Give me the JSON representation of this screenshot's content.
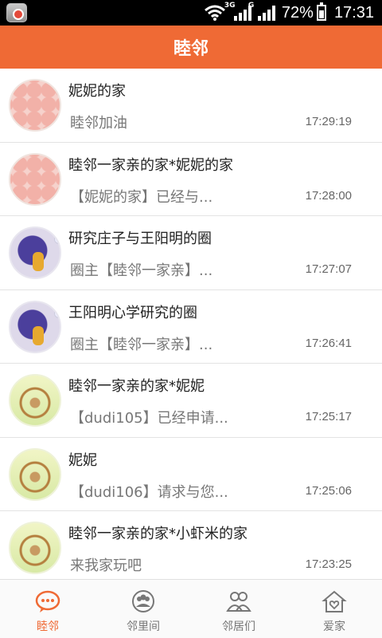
{
  "status_bar": {
    "network_type": "3G",
    "signal_label": "G",
    "battery_text": "72%",
    "battery_level": 0.72,
    "time": "17:31"
  },
  "app_bar": {
    "title": "睦邻"
  },
  "conversations": [
    {
      "name": "妮妮的家",
      "message": "睦邻加油",
      "time": "17:29:19",
      "avatar": "apples-photo"
    },
    {
      "name": "睦邻一家亲的家*妮妮的家",
      "message": "【妮妮的家】已经与...",
      "time": "17:28:00",
      "avatar": "apples-photo"
    },
    {
      "name": "研究庄子与王阳明的圈",
      "message": "圈主【睦邻一家亲】...",
      "time": "17:27:07",
      "avatar": "purple-art"
    },
    {
      "name": "王阳明心学研究的圈",
      "message": "圈主【睦邻一家亲】...",
      "time": "17:26:41",
      "avatar": "purple-art"
    },
    {
      "name": "睦邻一家亲的家*妮妮",
      "message": "【dudi105】已经申请...",
      "time": "17:25:17",
      "avatar": "wheel-illustration"
    },
    {
      "name": "妮妮",
      "message": "【dudi106】请求与您...",
      "time": "17:25:06",
      "avatar": "wheel-illustration"
    },
    {
      "name": "睦邻一家亲的家*小虾米的家",
      "message": "来我家玩吧",
      "time": "17:23:25",
      "avatar": "wheel-illustration"
    }
  ],
  "tabs": [
    {
      "label": "睦邻",
      "icon": "chat-bubble-icon",
      "active": true
    },
    {
      "label": "邻里间",
      "icon": "group-icon",
      "active": false
    },
    {
      "label": "邻居们",
      "icon": "people-icon",
      "active": false
    },
    {
      "label": "爱家",
      "icon": "home-heart-icon",
      "active": false
    }
  ],
  "colors": {
    "accent": "#ef6a35",
    "status_bar": "#000000",
    "divider": "#e3e3e3"
  }
}
